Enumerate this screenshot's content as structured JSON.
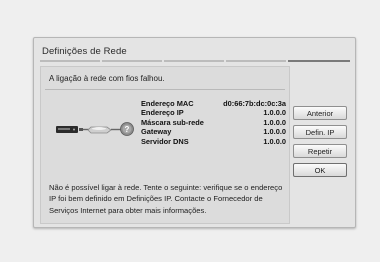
{
  "dialog": {
    "title": "Definições de Rede",
    "status_message": "A ligação à rede com fios falhou.",
    "info_rows": [
      {
        "label": "Endereço MAC",
        "value": "d0:66:7b:dc:0c:3a"
      },
      {
        "label": "Endereço IP",
        "value": "1.0.0.0"
      },
      {
        "label": "Máscara sub-rede",
        "value": "1.0.0.0"
      },
      {
        "label": "Gateway",
        "value": "1.0.0.0"
      },
      {
        "label": "Servidor DNS",
        "value": "1.0.0.0"
      }
    ],
    "help_text": "Não é possível ligar à rede. Tente o seguinte: verifique se o endereço IP foi bem definido em Definições IP. Contacte o Fornecedor de Serviços Internet para obter mais informações.",
    "buttons": {
      "previous": "Anterior",
      "ip_settings": "Defin. IP",
      "retry": "Repetir",
      "ok": "OK"
    },
    "diagram": {
      "device_icon": "player-device-icon",
      "router_icon": "router-icon",
      "internet_icon": "internet-question-icon",
      "error_mark": "?"
    }
  }
}
